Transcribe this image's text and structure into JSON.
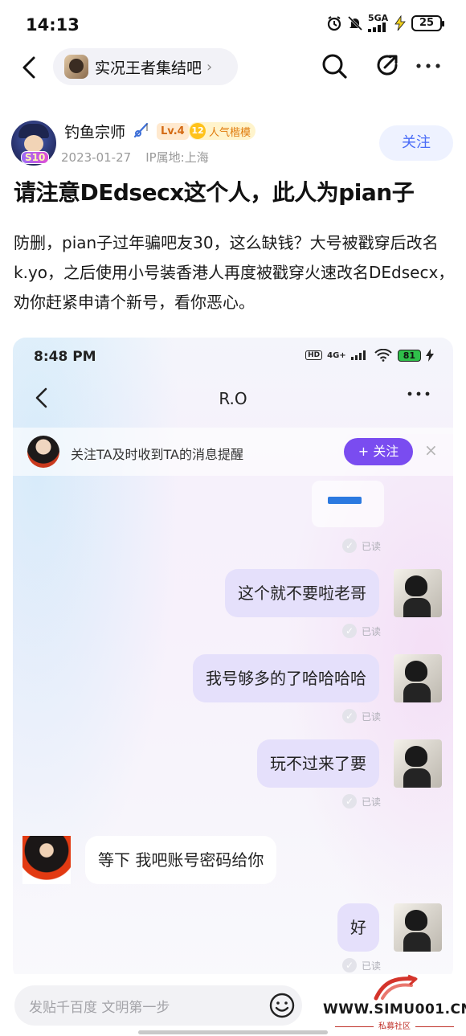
{
  "status_bar": {
    "time": "14:13",
    "network": "5GA",
    "battery": "25"
  },
  "nav": {
    "forum_name": "实况王者集结吧",
    "chevron": "›"
  },
  "author": {
    "name": "钓鱼宗师",
    "level": "Lv.4",
    "badge_num": "12",
    "badge_label": "人气楷模",
    "avatar_badge": "S10",
    "date": "2023-01-27",
    "ip": "IP属地:上海",
    "follow_label": "关注"
  },
  "post": {
    "title": "请注意DEdsecx这个人，此人为pian子",
    "body": "防删，pian子过年骗吧友30，这么缺钱？大号被戳穿后改名k.yo，之后使用小号装香港人再度被戳穿火速改名DEdsecx，劝你赶紧申请个新号，看你恶心。"
  },
  "screenshot": {
    "status_time": "8:48 PM",
    "status_hd": "HD",
    "status_net": "4G+",
    "status_battery": "81",
    "chat_title": "R.O",
    "notice_text": "关注TA及时收到TA的消息提醒",
    "notice_follow": "+ 关注",
    "notice_close": "×",
    "read_label": "已读",
    "messages": [
      {
        "side": "out",
        "text": "这个就不要啦老哥"
      },
      {
        "side": "out",
        "text": "我号够多的了哈哈哈哈"
      },
      {
        "side": "out",
        "text": "玩不过来了要"
      },
      {
        "side": "in",
        "text": "等下 我吧账号密码给你"
      },
      {
        "side": "out",
        "text": "好"
      }
    ]
  },
  "bottom": {
    "comment_placeholder": "发贴千百度 文明第一步",
    "watermark_url": "WWW.SIMU001.CN",
    "watermark_sub": "私募社区"
  },
  "icons": {
    "back": "back-arrow-icon",
    "search": "search-icon",
    "share": "share-icon",
    "more": "more-icon",
    "emoji": "emoji-icon",
    "alarm": "alarm-icon",
    "mute": "mute-icon",
    "signal": "signal-icon",
    "charging": "charging-icon"
  }
}
